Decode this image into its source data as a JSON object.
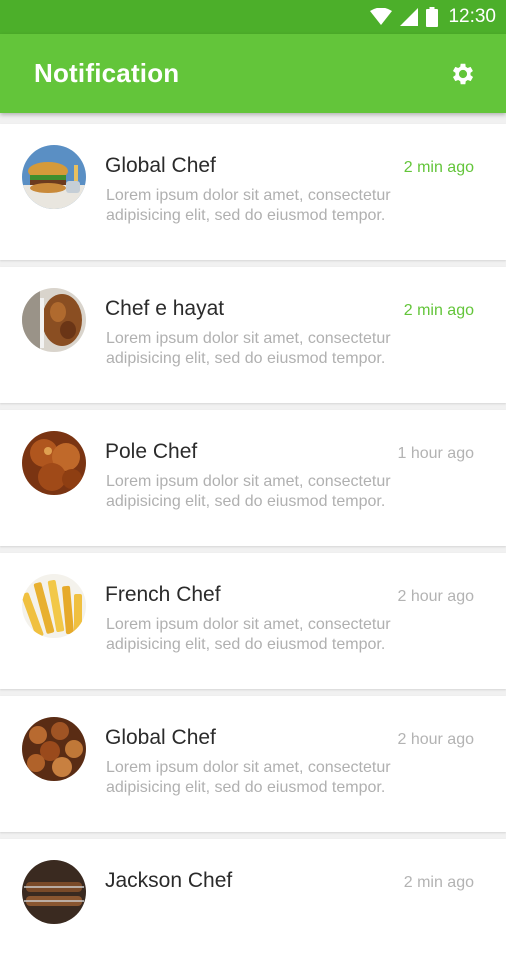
{
  "status_bar": {
    "time": "12:30",
    "icons": [
      "wifi-icon",
      "signal-icon",
      "battery-icon"
    ]
  },
  "app_bar": {
    "title": "Notification",
    "settings_icon": "gear-icon"
  },
  "colors": {
    "status_bar": "#4caf2a",
    "app_bar": "#63c53a",
    "accent_time": "#63c53a",
    "muted_time": "#b3b3b3"
  },
  "notifications": [
    {
      "name": "Global Chef",
      "time": "2 min ago",
      "recent": true,
      "message": "Lorem ipsum dolor sit amet, consectetur adipisicing elit, sed do eiusmod tempor.",
      "avatar": "burger-photo"
    },
    {
      "name": "Chef e hayat",
      "time": "2 min ago",
      "recent": true,
      "message": "Lorem ipsum dolor sit amet, consectetur adipisicing elit, sed do eiusmod tempor.",
      "avatar": "grilled-meat-photo"
    },
    {
      "name": "Pole Chef",
      "time": "1 hour ago",
      "recent": false,
      "message": "Lorem ipsum dolor sit amet, consectetur adipisicing elit, sed do eiusmod tempor.",
      "avatar": "roast-chicken-photo"
    },
    {
      "name": "French Chef",
      "time": "2 hour ago",
      "recent": false,
      "message": "Lorem ipsum dolor sit amet, consectetur adipisicing elit, sed do eiusmod tempor.",
      "avatar": "fries-photo"
    },
    {
      "name": "Global Chef",
      "time": "2 hour ago",
      "recent": false,
      "message": "Lorem ipsum dolor sit amet, consectetur adipisicing elit, sed do eiusmod tempor.",
      "avatar": "kebab-photo"
    },
    {
      "name": "Jackson Chef",
      "time": "2 min ago",
      "recent": false,
      "message": "",
      "avatar": "skewers-photo"
    }
  ]
}
